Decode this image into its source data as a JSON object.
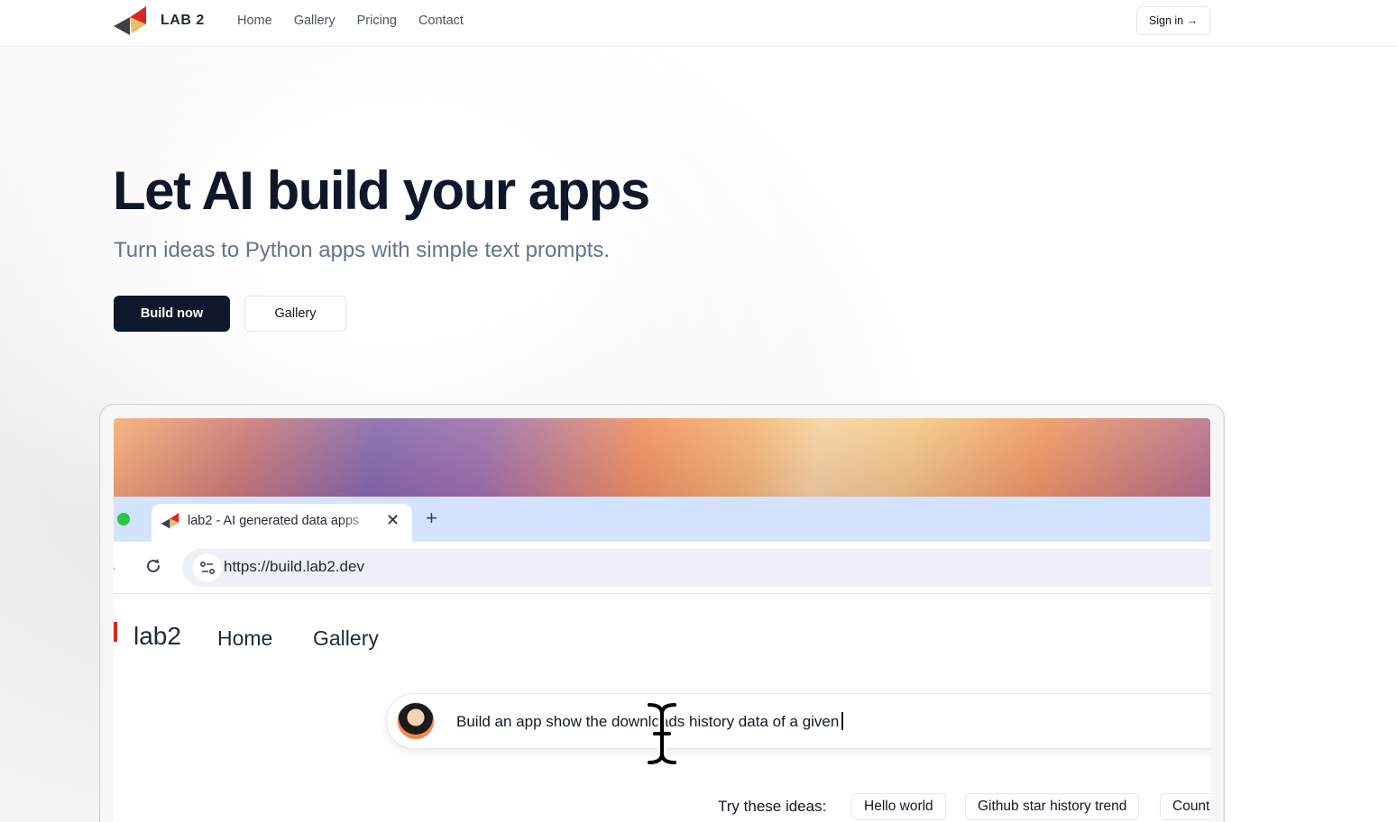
{
  "navbar": {
    "brand": "LAB 2",
    "links": [
      "Home",
      "Gallery",
      "Pricing",
      "Contact"
    ],
    "signin": "Sign in →"
  },
  "hero": {
    "title": "Let AI build your apps",
    "subtitle": "Turn ideas to Python apps with simple text prompts.",
    "build_label": "Build now",
    "gallery_label": "Gallery"
  },
  "browser": {
    "tab_title": "lab2 - AI generated data apps",
    "url": "https://build.lab2.dev"
  },
  "inner": {
    "brand": "lab2",
    "nav": [
      "Home",
      "Gallery"
    ],
    "prompt": "Build an app show the downloads history data of a given",
    "ideas_label": "Try these ideas:",
    "ideas": [
      "Hello world",
      "Github star history trend",
      "Count"
    ]
  },
  "colors": {
    "primary": "#0f172a",
    "tabstrip": "#d3e3fd",
    "traffic_green": "#28c840"
  }
}
